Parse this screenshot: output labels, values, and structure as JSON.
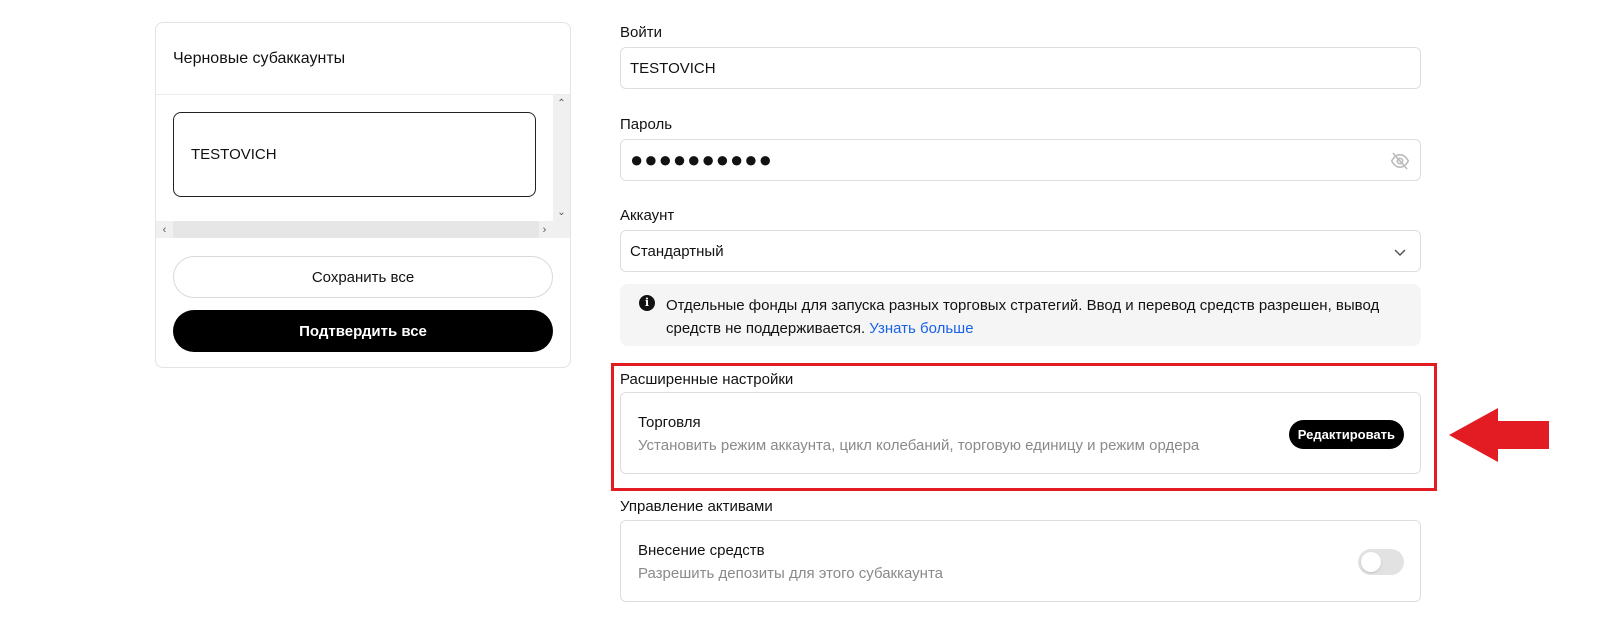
{
  "left_panel": {
    "title": "Черновые субаккаунты",
    "subaccount_name": "TESTOVICH",
    "save_all_label": "Сохранить все",
    "confirm_all_label": "Подтвердить все"
  },
  "form": {
    "login_label": "Войти",
    "login_value": "TESTOVICH",
    "password_label": "Пароль",
    "password_value": "●●●●●●●●●●",
    "account_label": "Аккаунт",
    "account_value": "Стандартный",
    "info_text": "Отдельные фонды для запуска разных торговых стратегий. Ввод и перевод средств разрешен, вывод средств не поддерживается.",
    "info_link": "Узнать больше"
  },
  "advanced": {
    "section_label": "Расширенные настройки",
    "trading_title": "Торговля",
    "trading_desc": "Установить режим аккаунта, цикл колебаний, торговую единицу и режим ордера",
    "edit_label": "Редактировать"
  },
  "assets": {
    "section_label": "Управление активами",
    "deposit_title": "Внесение средств",
    "deposit_desc": "Разрешить депозиты для этого субаккаунта",
    "deposit_enabled": false
  },
  "icons": {
    "password_toggle": "eye-off-icon",
    "account_dropdown": "chevron-down-icon",
    "info": "info-icon",
    "annotation": "red-arrow-left"
  },
  "colors": {
    "highlight": "#e31b23",
    "link": "#1a63e8",
    "primary_button": "#000000"
  }
}
